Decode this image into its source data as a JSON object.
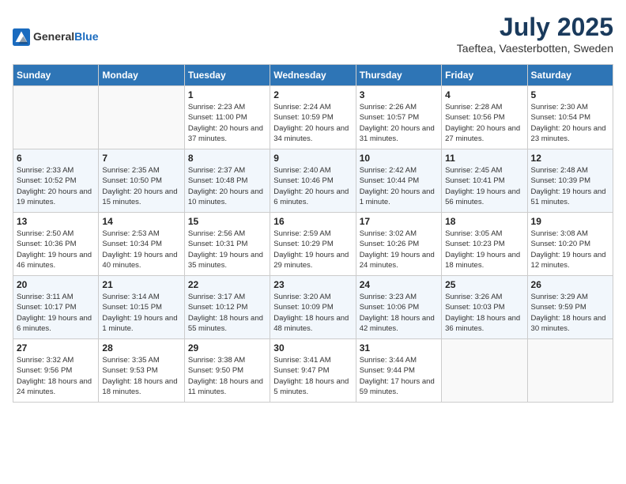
{
  "logo": {
    "general": "General",
    "blue": "Blue"
  },
  "title": "July 2025",
  "subtitle": "Taeftea, Vaesterbotten, Sweden",
  "headers": [
    "Sunday",
    "Monday",
    "Tuesday",
    "Wednesday",
    "Thursday",
    "Friday",
    "Saturday"
  ],
  "weeks": [
    [
      {
        "day": "",
        "info": ""
      },
      {
        "day": "",
        "info": ""
      },
      {
        "day": "1",
        "info": "Sunrise: 2:23 AM\nSunset: 11:00 PM\nDaylight: 20 hours\nand 37 minutes."
      },
      {
        "day": "2",
        "info": "Sunrise: 2:24 AM\nSunset: 10:59 PM\nDaylight: 20 hours\nand 34 minutes."
      },
      {
        "day": "3",
        "info": "Sunrise: 2:26 AM\nSunset: 10:57 PM\nDaylight: 20 hours\nand 31 minutes."
      },
      {
        "day": "4",
        "info": "Sunrise: 2:28 AM\nSunset: 10:56 PM\nDaylight: 20 hours\nand 27 minutes."
      },
      {
        "day": "5",
        "info": "Sunrise: 2:30 AM\nSunset: 10:54 PM\nDaylight: 20 hours\nand 23 minutes."
      }
    ],
    [
      {
        "day": "6",
        "info": "Sunrise: 2:33 AM\nSunset: 10:52 PM\nDaylight: 20 hours\nand 19 minutes."
      },
      {
        "day": "7",
        "info": "Sunrise: 2:35 AM\nSunset: 10:50 PM\nDaylight: 20 hours\nand 15 minutes."
      },
      {
        "day": "8",
        "info": "Sunrise: 2:37 AM\nSunset: 10:48 PM\nDaylight: 20 hours\nand 10 minutes."
      },
      {
        "day": "9",
        "info": "Sunrise: 2:40 AM\nSunset: 10:46 PM\nDaylight: 20 hours\nand 6 minutes."
      },
      {
        "day": "10",
        "info": "Sunrise: 2:42 AM\nSunset: 10:44 PM\nDaylight: 20 hours\nand 1 minute."
      },
      {
        "day": "11",
        "info": "Sunrise: 2:45 AM\nSunset: 10:41 PM\nDaylight: 19 hours\nand 56 minutes."
      },
      {
        "day": "12",
        "info": "Sunrise: 2:48 AM\nSunset: 10:39 PM\nDaylight: 19 hours\nand 51 minutes."
      }
    ],
    [
      {
        "day": "13",
        "info": "Sunrise: 2:50 AM\nSunset: 10:36 PM\nDaylight: 19 hours\nand 46 minutes."
      },
      {
        "day": "14",
        "info": "Sunrise: 2:53 AM\nSunset: 10:34 PM\nDaylight: 19 hours\nand 40 minutes."
      },
      {
        "day": "15",
        "info": "Sunrise: 2:56 AM\nSunset: 10:31 PM\nDaylight: 19 hours\nand 35 minutes."
      },
      {
        "day": "16",
        "info": "Sunrise: 2:59 AM\nSunset: 10:29 PM\nDaylight: 19 hours\nand 29 minutes."
      },
      {
        "day": "17",
        "info": "Sunrise: 3:02 AM\nSunset: 10:26 PM\nDaylight: 19 hours\nand 24 minutes."
      },
      {
        "day": "18",
        "info": "Sunrise: 3:05 AM\nSunset: 10:23 PM\nDaylight: 19 hours\nand 18 minutes."
      },
      {
        "day": "19",
        "info": "Sunrise: 3:08 AM\nSunset: 10:20 PM\nDaylight: 19 hours\nand 12 minutes."
      }
    ],
    [
      {
        "day": "20",
        "info": "Sunrise: 3:11 AM\nSunset: 10:17 PM\nDaylight: 19 hours\nand 6 minutes."
      },
      {
        "day": "21",
        "info": "Sunrise: 3:14 AM\nSunset: 10:15 PM\nDaylight: 19 hours\nand 1 minute."
      },
      {
        "day": "22",
        "info": "Sunrise: 3:17 AM\nSunset: 10:12 PM\nDaylight: 18 hours\nand 55 minutes."
      },
      {
        "day": "23",
        "info": "Sunrise: 3:20 AM\nSunset: 10:09 PM\nDaylight: 18 hours\nand 48 minutes."
      },
      {
        "day": "24",
        "info": "Sunrise: 3:23 AM\nSunset: 10:06 PM\nDaylight: 18 hours\nand 42 minutes."
      },
      {
        "day": "25",
        "info": "Sunrise: 3:26 AM\nSunset: 10:03 PM\nDaylight: 18 hours\nand 36 minutes."
      },
      {
        "day": "26",
        "info": "Sunrise: 3:29 AM\nSunset: 9:59 PM\nDaylight: 18 hours\nand 30 minutes."
      }
    ],
    [
      {
        "day": "27",
        "info": "Sunrise: 3:32 AM\nSunset: 9:56 PM\nDaylight: 18 hours\nand 24 minutes."
      },
      {
        "day": "28",
        "info": "Sunrise: 3:35 AM\nSunset: 9:53 PM\nDaylight: 18 hours\nand 18 minutes."
      },
      {
        "day": "29",
        "info": "Sunrise: 3:38 AM\nSunset: 9:50 PM\nDaylight: 18 hours\nand 11 minutes."
      },
      {
        "day": "30",
        "info": "Sunrise: 3:41 AM\nSunset: 9:47 PM\nDaylight: 18 hours\nand 5 minutes."
      },
      {
        "day": "31",
        "info": "Sunrise: 3:44 AM\nSunset: 9:44 PM\nDaylight: 17 hours\nand 59 minutes."
      },
      {
        "day": "",
        "info": ""
      },
      {
        "day": "",
        "info": ""
      }
    ]
  ]
}
